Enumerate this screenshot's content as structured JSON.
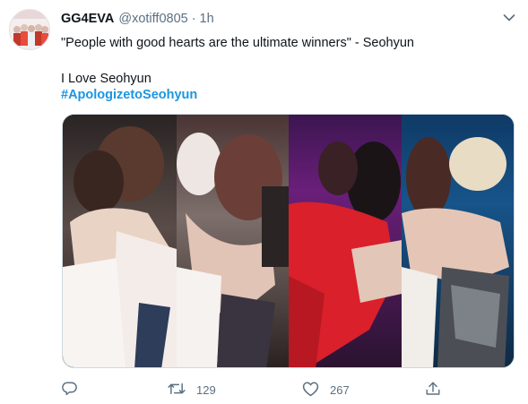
{
  "tweet": {
    "display_name": "GG4EVA",
    "handle": "@xotiff0805",
    "separator": "·",
    "time": "1h",
    "line1": "\"People with good hearts are the ultimate winners\" - Seohyun",
    "line2": "I Love Seohyun",
    "hashtag": "#ApologizetoSeohyun"
  },
  "actions": {
    "retweets": "129",
    "likes": "267"
  },
  "colors": {
    "link": "#1b95e0",
    "muted": "#5b7083",
    "text": "#0f1419"
  },
  "icons": {
    "avatar": "avatar",
    "more": "chevron-down-icon",
    "reply": "reply-icon",
    "retweet": "retweet-icon",
    "like": "heart-icon",
    "share": "share-icon"
  }
}
